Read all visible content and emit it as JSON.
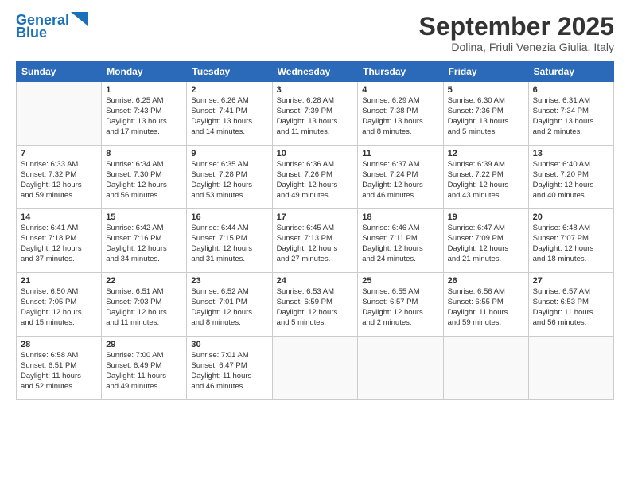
{
  "header": {
    "logo_line1": "General",
    "logo_line2": "Blue",
    "month": "September 2025",
    "location": "Dolina, Friuli Venezia Giulia, Italy"
  },
  "days_of_week": [
    "Sunday",
    "Monday",
    "Tuesday",
    "Wednesday",
    "Thursday",
    "Friday",
    "Saturday"
  ],
  "weeks": [
    [
      {
        "day": "",
        "info": ""
      },
      {
        "day": "1",
        "info": "Sunrise: 6:25 AM\nSunset: 7:43 PM\nDaylight: 13 hours\nand 17 minutes."
      },
      {
        "day": "2",
        "info": "Sunrise: 6:26 AM\nSunset: 7:41 PM\nDaylight: 13 hours\nand 14 minutes."
      },
      {
        "day": "3",
        "info": "Sunrise: 6:28 AM\nSunset: 7:39 PM\nDaylight: 13 hours\nand 11 minutes."
      },
      {
        "day": "4",
        "info": "Sunrise: 6:29 AM\nSunset: 7:38 PM\nDaylight: 13 hours\nand 8 minutes."
      },
      {
        "day": "5",
        "info": "Sunrise: 6:30 AM\nSunset: 7:36 PM\nDaylight: 13 hours\nand 5 minutes."
      },
      {
        "day": "6",
        "info": "Sunrise: 6:31 AM\nSunset: 7:34 PM\nDaylight: 13 hours\nand 2 minutes."
      }
    ],
    [
      {
        "day": "7",
        "info": "Sunrise: 6:33 AM\nSunset: 7:32 PM\nDaylight: 12 hours\nand 59 minutes."
      },
      {
        "day": "8",
        "info": "Sunrise: 6:34 AM\nSunset: 7:30 PM\nDaylight: 12 hours\nand 56 minutes."
      },
      {
        "day": "9",
        "info": "Sunrise: 6:35 AM\nSunset: 7:28 PM\nDaylight: 12 hours\nand 53 minutes."
      },
      {
        "day": "10",
        "info": "Sunrise: 6:36 AM\nSunset: 7:26 PM\nDaylight: 12 hours\nand 49 minutes."
      },
      {
        "day": "11",
        "info": "Sunrise: 6:37 AM\nSunset: 7:24 PM\nDaylight: 12 hours\nand 46 minutes."
      },
      {
        "day": "12",
        "info": "Sunrise: 6:39 AM\nSunset: 7:22 PM\nDaylight: 12 hours\nand 43 minutes."
      },
      {
        "day": "13",
        "info": "Sunrise: 6:40 AM\nSunset: 7:20 PM\nDaylight: 12 hours\nand 40 minutes."
      }
    ],
    [
      {
        "day": "14",
        "info": "Sunrise: 6:41 AM\nSunset: 7:18 PM\nDaylight: 12 hours\nand 37 minutes."
      },
      {
        "day": "15",
        "info": "Sunrise: 6:42 AM\nSunset: 7:16 PM\nDaylight: 12 hours\nand 34 minutes."
      },
      {
        "day": "16",
        "info": "Sunrise: 6:44 AM\nSunset: 7:15 PM\nDaylight: 12 hours\nand 31 minutes."
      },
      {
        "day": "17",
        "info": "Sunrise: 6:45 AM\nSunset: 7:13 PM\nDaylight: 12 hours\nand 27 minutes."
      },
      {
        "day": "18",
        "info": "Sunrise: 6:46 AM\nSunset: 7:11 PM\nDaylight: 12 hours\nand 24 minutes."
      },
      {
        "day": "19",
        "info": "Sunrise: 6:47 AM\nSunset: 7:09 PM\nDaylight: 12 hours\nand 21 minutes."
      },
      {
        "day": "20",
        "info": "Sunrise: 6:48 AM\nSunset: 7:07 PM\nDaylight: 12 hours\nand 18 minutes."
      }
    ],
    [
      {
        "day": "21",
        "info": "Sunrise: 6:50 AM\nSunset: 7:05 PM\nDaylight: 12 hours\nand 15 minutes."
      },
      {
        "day": "22",
        "info": "Sunrise: 6:51 AM\nSunset: 7:03 PM\nDaylight: 12 hours\nand 11 minutes."
      },
      {
        "day": "23",
        "info": "Sunrise: 6:52 AM\nSunset: 7:01 PM\nDaylight: 12 hours\nand 8 minutes."
      },
      {
        "day": "24",
        "info": "Sunrise: 6:53 AM\nSunset: 6:59 PM\nDaylight: 12 hours\nand 5 minutes."
      },
      {
        "day": "25",
        "info": "Sunrise: 6:55 AM\nSunset: 6:57 PM\nDaylight: 12 hours\nand 2 minutes."
      },
      {
        "day": "26",
        "info": "Sunrise: 6:56 AM\nSunset: 6:55 PM\nDaylight: 11 hours\nand 59 minutes."
      },
      {
        "day": "27",
        "info": "Sunrise: 6:57 AM\nSunset: 6:53 PM\nDaylight: 11 hours\nand 56 minutes."
      }
    ],
    [
      {
        "day": "28",
        "info": "Sunrise: 6:58 AM\nSunset: 6:51 PM\nDaylight: 11 hours\nand 52 minutes."
      },
      {
        "day": "29",
        "info": "Sunrise: 7:00 AM\nSunset: 6:49 PM\nDaylight: 11 hours\nand 49 minutes."
      },
      {
        "day": "30",
        "info": "Sunrise: 7:01 AM\nSunset: 6:47 PM\nDaylight: 11 hours\nand 46 minutes."
      },
      {
        "day": "",
        "info": ""
      },
      {
        "day": "",
        "info": ""
      },
      {
        "day": "",
        "info": ""
      },
      {
        "day": "",
        "info": ""
      }
    ]
  ]
}
